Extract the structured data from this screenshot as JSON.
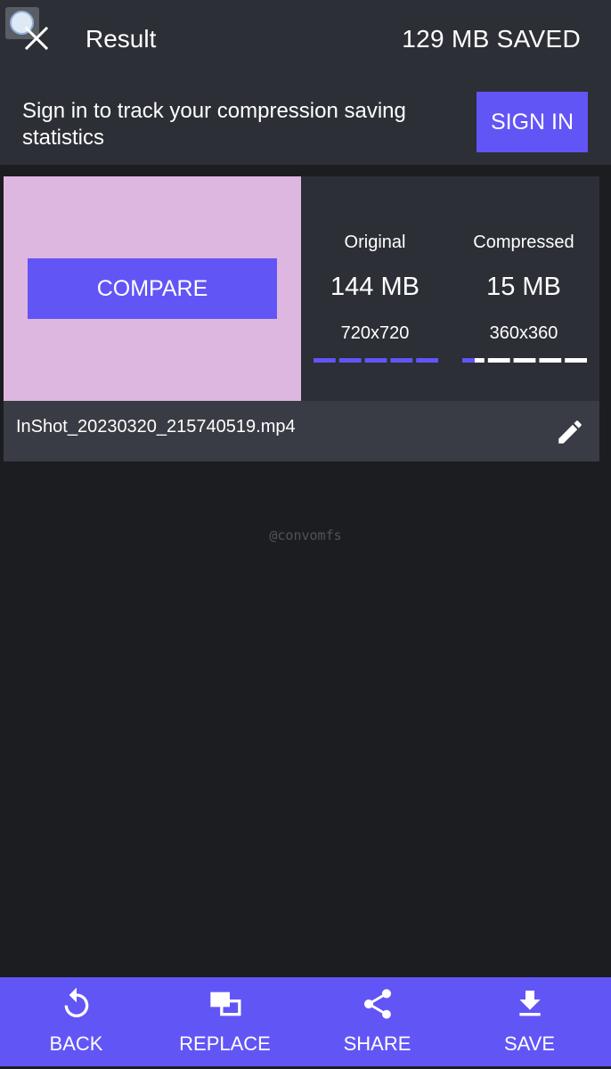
{
  "header": {
    "title": "Result",
    "saved_text": "129 MB SAVED"
  },
  "signin": {
    "message": "Sign in to track your compression saving statistics",
    "button_label": "SIGN IN"
  },
  "result": {
    "compare_label": "COMPARE",
    "thumbnail_color": "#deb7e0",
    "original": {
      "label": "Original",
      "size": "144 MB",
      "resolution": "720x720",
      "level_fraction": 1.0
    },
    "compressed": {
      "label": "Compressed",
      "size": "15 MB",
      "resolution": "360x360",
      "level_fraction": 0.1
    },
    "file_name": "InShot_20230320_215740519.mp4"
  },
  "watermark": "@convomfs",
  "bottom_nav": {
    "back_label": "BACK",
    "replace_label": "REPLACE",
    "share_label": "SHARE",
    "save_label": "SAVE"
  },
  "colors": {
    "accent": "#6255f6",
    "background": "#1c1d21",
    "panel": "#2c2f36",
    "file_row": "#393c44"
  },
  "icons": {
    "close": "close-icon",
    "edit": "pencil-icon",
    "back": "undo-icon",
    "replace": "replace-icon",
    "share": "share-icon",
    "save": "download-icon"
  }
}
